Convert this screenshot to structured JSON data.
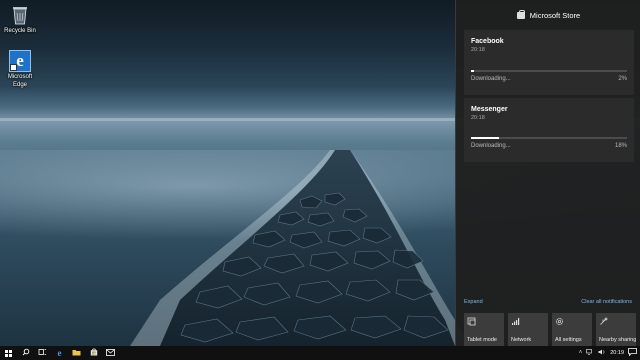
{
  "desktop": {
    "icons": [
      {
        "label": "Recycle Bin"
      },
      {
        "label": "Microsoft Edge"
      }
    ]
  },
  "action_center": {
    "header": {
      "title": "Microsoft Store",
      "icon": "store-bag-icon"
    },
    "notifications": [
      {
        "title": "Facebook",
        "time": "20:18",
        "status": "Downloading...",
        "percent_text": "2%",
        "progress": 0.02
      },
      {
        "title": "Messenger",
        "time": "20:18",
        "status": "Downloading...",
        "percent_text": "18%",
        "progress": 0.18
      }
    ],
    "expand_label": "Expand",
    "clear_label": "Clear all notifications",
    "quick_actions": [
      {
        "label": "Tablet mode",
        "icon": "tablet-mode-icon"
      },
      {
        "label": "Network",
        "icon": "network-icon"
      },
      {
        "label": "All settings",
        "icon": "gear-icon"
      },
      {
        "label": "Nearby sharing",
        "icon": "nearby-sharing-icon"
      }
    ]
  },
  "taskbar": {
    "clock": "20:19",
    "apps": [
      "start-icon",
      "search-icon",
      "task-view-icon",
      "edge-icon",
      "file-explorer-icon",
      "store-icon",
      "mail-icon"
    ]
  },
  "colors": {
    "accent_link": "#7eb6ef",
    "panel_bg": "#1f1f1f",
    "card_bg": "#2b2b2b",
    "tile_bg": "#3c3c3c"
  }
}
